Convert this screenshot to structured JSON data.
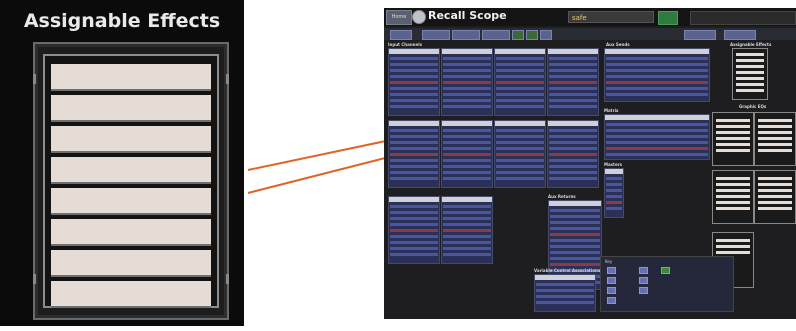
{
  "zoom": {
    "title": "Assignable Effects",
    "slot_count": 8
  },
  "screen": {
    "title": "Recall Scope",
    "scope_value": "safe",
    "home_label": "Home",
    "sections": {
      "input_channels": "Input Channels",
      "aux_sends": "Aux Sends",
      "assignable_effects": "Assignable Effects",
      "matrix": "Matrix",
      "graphic_eqs": "Graphic EQs",
      "masters": "Masters",
      "aux_returns": "Aux Returns",
      "vca": "Variable Control Associations",
      "key": "Key"
    }
  },
  "colors": {
    "accent_line": "#e0642a",
    "slot": "#e6dcd6",
    "strip": "#2b3056",
    "strip_row": "#4a55a0"
  }
}
